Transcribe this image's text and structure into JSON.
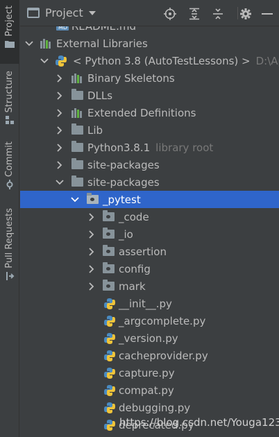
{
  "tool_strip": {
    "tabs": [
      {
        "label": "Project",
        "icon": "folder-icon"
      },
      {
        "label": "Structure",
        "icon": "structure-icon"
      },
      {
        "label": "Commit",
        "icon": "commit-icon"
      },
      {
        "label": "Pull Requests",
        "icon": "pull-request-icon"
      }
    ]
  },
  "header": {
    "title": "Project",
    "buttons": [
      "locate-icon",
      "expand-all-icon",
      "collapse-all-icon",
      "settings-gear-icon",
      "hide-icon"
    ]
  },
  "tree": {
    "partial_top_item": "README.md",
    "external_libraries": "External Libraries",
    "sdk": "< Python 3.8 (AutoTestLessons) >",
    "sdk_path": "D:\\App",
    "library_items": [
      {
        "label": "Binary Skeletons",
        "icon": "library-icon"
      },
      {
        "label": "DLLs",
        "icon": "folder-icon"
      },
      {
        "label": "Extended Definitions",
        "icon": "library-icon"
      },
      {
        "label": "Lib",
        "icon": "folder-icon"
      },
      {
        "label": "Python3.8.1",
        "icon": "folder-icon",
        "hint": "library root"
      },
      {
        "label": "site-packages",
        "icon": "folder-icon"
      },
      {
        "label": "site-packages",
        "icon": "folder-icon"
      }
    ],
    "selected": "_pytest",
    "subpackages": [
      "_code",
      "_io",
      "assertion",
      "config",
      "mark"
    ],
    "files": [
      "__init__.py",
      "_argcomplete.py",
      "_version.py",
      "cacheprovider.py",
      "capture.py",
      "compat.py",
      "debugging.py",
      "deprecated.py"
    ]
  },
  "watermark": "https://blog.csdn.net/Youga123",
  "colors": {
    "background": "#3c3f41",
    "selection": "#2f65ca",
    "text": "#bbbbbb",
    "hint": "#787878",
    "python_blue": "#4a8bc2",
    "python_yellow": "#f0c43a"
  }
}
